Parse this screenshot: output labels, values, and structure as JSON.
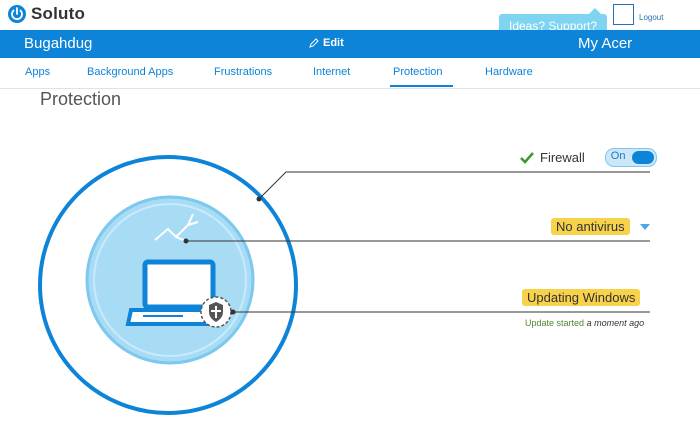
{
  "app": {
    "name": "Soluto"
  },
  "topbar": {
    "support_label": "Ideas? Support?",
    "logout_label": "Logout"
  },
  "header": {
    "device_name": "Bugahdug",
    "edit_label": "Edit",
    "account_name": "My Acer"
  },
  "tabs": [
    {
      "label": "Apps"
    },
    {
      "label": "Background Apps"
    },
    {
      "label": "Frustrations"
    },
    {
      "label": "Internet"
    },
    {
      "label": "Protection",
      "active": true
    },
    {
      "label": "Hardware"
    }
  ],
  "page": {
    "title": "Protection"
  },
  "firewall": {
    "label": "Firewall",
    "toggle_label": "On",
    "status_color": "#3a9a2a"
  },
  "antivirus": {
    "label": "No antivirus"
  },
  "windows_update": {
    "label": "Updating Windows",
    "status_prefix": "Update started",
    "status_time": "a moment ago"
  },
  "colors": {
    "accent": "#0d84d8",
    "badge": "#f7d24a",
    "bubble": "#7fd4f2"
  }
}
